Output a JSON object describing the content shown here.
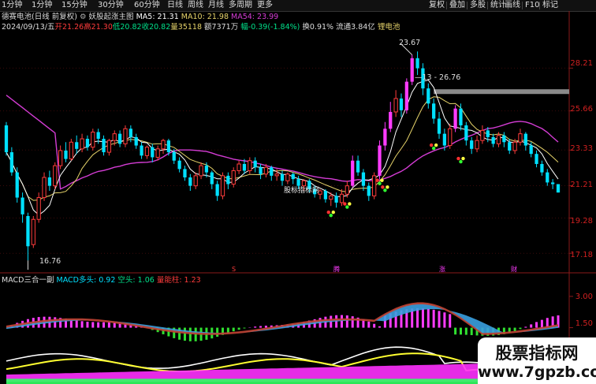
{
  "toolbar": {
    "left_items": [
      "1分钟",
      "1分钟",
      "15分钟",
      "30分钟",
      "60分钟",
      "日线",
      "周线",
      "月线",
      "多周期",
      "更多"
    ],
    "right_items": [
      "复权",
      "叠加",
      "多股",
      "统计",
      "画线",
      "F10",
      "标记"
    ]
  },
  "header": {
    "stock_name": "德赛电池(日线 前复权)",
    "indicator_name": "妖股起涨主图",
    "ma5_label": "MA5: 21.31",
    "ma10_label": "MA10: 21.98",
    "ma54_label": "MA54: 23.99"
  },
  "quote": {
    "date": "2024/09/13/五",
    "open": "开21.26",
    "high": "高21.30",
    "low": "低20.82",
    "close": "收20.82",
    "volume": "量35118",
    "amount": "额7371万",
    "change": "幅-0.39(-1.84%)",
    "turnover": "换0.91%",
    "float_cap": "流通3.84亿",
    "sector": "锂电池"
  },
  "annotations": {
    "peak": "23.67",
    "low": "16.76",
    "level": "—13 - 26.76",
    "site_mark": "股标指标网"
  },
  "signal_marks": [
    "S",
    "腾",
    "涨",
    "财"
  ],
  "price_axis": [
    "28.21",
    "25.66",
    "23.33",
    "21.21",
    "19.28",
    "17.18"
  ],
  "macd": {
    "name": "MACD三合一副",
    "l1": "MACD多头: 0.92",
    "l2": "空头: 1.06",
    "l3": "量能柱: 1.23",
    "axis": [
      "3.00",
      "1.50"
    ]
  },
  "watermark": {
    "title": "股票指标网",
    "url": "www.7gpzb.com"
  },
  "colors": {
    "up": "#ff3c3c",
    "down": "#00e0ff",
    "ma5": "#ffffff",
    "ma10": "#e6d36a",
    "ma54": "#d43cd4",
    "highlight": "#ff3cff"
  },
  "chart_data": {
    "type": "candlestick",
    "note_series": "daily OHLC, approximated",
    "candles": [
      [
        24.8,
        23.2,
        25.0,
        23.0
      ],
      [
        23.2,
        22.0,
        23.5,
        21.8
      ],
      [
        22.0,
        20.5,
        22.3,
        20.2
      ],
      [
        20.5,
        19.5,
        20.8,
        19.0
      ],
      [
        19.4,
        17.6,
        19.6,
        16.76
      ],
      [
        17.7,
        19.2,
        19.4,
        17.5
      ],
      [
        19.2,
        20.5,
        20.8,
        19.0
      ],
      [
        20.5,
        21.7,
        22.0,
        20.3
      ],
      [
        21.7,
        21.2,
        22.1,
        20.9
      ],
      [
        21.2,
        22.4,
        22.6,
        21.0
      ],
      [
        22.4,
        23.3,
        23.6,
        22.2
      ],
      [
        23.3,
        22.8,
        23.8,
        22.6
      ],
      [
        22.8,
        23.8,
        24.0,
        22.7
      ],
      [
        23.8,
        23.4,
        24.2,
        23.1
      ],
      [
        23.4,
        24.0,
        24.3,
        23.2
      ],
      [
        24.0,
        23.5,
        24.2,
        23.3
      ],
      [
        23.5,
        24.4,
        24.6,
        23.3
      ],
      [
        24.4,
        24.0,
        24.6,
        23.7
      ],
      [
        24.0,
        23.2,
        24.2,
        23.0
      ],
      [
        23.2,
        23.9,
        24.0,
        23.0
      ],
      [
        23.9,
        24.3,
        24.5,
        23.6
      ],
      [
        24.3,
        23.7,
        24.5,
        23.5
      ],
      [
        23.7,
        24.6,
        24.8,
        23.5
      ],
      [
        24.6,
        24.1,
        24.8,
        23.8
      ],
      [
        24.1,
        23.6,
        24.3,
        23.4
      ],
      [
        23.6,
        23.0,
        23.8,
        22.8
      ],
      [
        23.0,
        23.5,
        23.6,
        22.8
      ],
      [
        23.5,
        22.9,
        23.7,
        22.6
      ],
      [
        22.9,
        23.4,
        23.6,
        22.7
      ],
      [
        23.4,
        23.9,
        24.0,
        23.1
      ],
      [
        23.9,
        23.2,
        24.0,
        23.0
      ],
      [
        23.2,
        22.7,
        23.4,
        22.5
      ],
      [
        22.7,
        22.2,
        22.9,
        22.0
      ],
      [
        22.2,
        21.7,
        22.4,
        21.5
      ],
      [
        21.7,
        21.2,
        21.9,
        20.9
      ],
      [
        21.2,
        21.8,
        22.0,
        21.0
      ],
      [
        21.8,
        22.4,
        22.6,
        21.6
      ],
      [
        22.4,
        22.0,
        22.6,
        21.7
      ],
      [
        22.0,
        21.3,
        22.1,
        21.0
      ],
      [
        21.3,
        20.6,
        21.5,
        20.3
      ],
      [
        20.6,
        21.8,
        22.0,
        20.4
      ],
      [
        21.8,
        21.3,
        22.0,
        21.0
      ],
      [
        21.3,
        22.1,
        22.3,
        21.1
      ],
      [
        22.1,
        22.5,
        22.7,
        21.9
      ],
      [
        22.5,
        22.1,
        22.8,
        21.9
      ],
      [
        22.1,
        22.7,
        22.9,
        21.9
      ],
      [
        22.7,
        22.3,
        22.9,
        22.0
      ],
      [
        22.3,
        21.9,
        22.5,
        21.6
      ],
      [
        21.9,
        22.3,
        22.5,
        21.7
      ],
      [
        22.3,
        21.8,
        22.4,
        21.5
      ],
      [
        21.8,
        21.9,
        22.2,
        21.5
      ],
      [
        21.9,
        21.5,
        22.1,
        21.2
      ],
      [
        21.5,
        21.9,
        22.0,
        21.3
      ],
      [
        21.9,
        21.6,
        22.0,
        21.3
      ],
      [
        21.6,
        21.2,
        21.8,
        21.0
      ],
      [
        21.2,
        21.5,
        21.6,
        20.9
      ],
      [
        21.5,
        21.0,
        21.6,
        20.8
      ],
      [
        21.0,
        20.7,
        21.2,
        20.5
      ],
      [
        20.7,
        20.9,
        21.0,
        20.4
      ],
      [
        20.9,
        20.4,
        21.0,
        20.2
      ],
      [
        20.4,
        20.6,
        20.8,
        20.0
      ],
      [
        20.6,
        20.2,
        20.8,
        19.9
      ],
      [
        20.2,
        20.7,
        21.0,
        20.0
      ],
      [
        20.7,
        21.2,
        21.5,
        20.5
      ],
      [
        21.2,
        22.7,
        23.0,
        21.1
      ],
      [
        22.7,
        22.0,
        23.0,
        21.8
      ],
      [
        22.0,
        21.2,
        22.2,
        20.9
      ],
      [
        21.2,
        20.6,
        21.4,
        20.3
      ],
      [
        20.6,
        21.8,
        22.0,
        20.4
      ],
      [
        21.8,
        23.6,
        23.9,
        21.6
      ],
      [
        23.6,
        24.6,
        25.0,
        23.3
      ],
      [
        24.6,
        25.6,
        26.2,
        24.4
      ],
      [
        25.6,
        26.4,
        26.9,
        25.3
      ],
      [
        26.4,
        25.7,
        26.7,
        25.3
      ],
      [
        25.7,
        27.4,
        27.6,
        25.5
      ],
      [
        27.4,
        28.8,
        29.0,
        27.2
      ],
      [
        28.8,
        28.2,
        29.2,
        27.8
      ],
      [
        28.2,
        27.0,
        28.5,
        26.6
      ],
      [
        27.0,
        26.1,
        27.3,
        25.8
      ],
      [
        26.1,
        25.2,
        26.4,
        24.9
      ],
      [
        25.2,
        24.3,
        25.6,
        24.0
      ],
      [
        24.3,
        23.6,
        24.6,
        23.3
      ],
      [
        23.6,
        24.6,
        24.9,
        23.4
      ],
      [
        24.6,
        25.8,
        26.0,
        24.4
      ],
      [
        25.8,
        24.8,
        26.1,
        24.5
      ],
      [
        24.8,
        23.9,
        25.0,
        23.6
      ],
      [
        23.9,
        23.4,
        24.1,
        23.1
      ],
      [
        23.4,
        23.9,
        24.2,
        23.2
      ],
      [
        23.9,
        24.5,
        24.8,
        23.7
      ],
      [
        24.5,
        24.1,
        24.7,
        23.8
      ],
      [
        24.1,
        23.7,
        24.3,
        23.5
      ],
      [
        23.7,
        24.2,
        24.4,
        23.5
      ],
      [
        24.2,
        23.8,
        24.4,
        23.5
      ],
      [
        23.8,
        23.3,
        24.0,
        23.1
      ],
      [
        23.3,
        23.8,
        24.0,
        23.1
      ],
      [
        23.8,
        24.3,
        24.6,
        23.6
      ],
      [
        24.3,
        23.6,
        24.4,
        23.3
      ],
      [
        23.6,
        23.1,
        23.8,
        22.9
      ],
      [
        23.1,
        22.5,
        23.3,
        22.3
      ],
      [
        22.5,
        22.0,
        22.7,
        21.8
      ],
      [
        22.0,
        21.4,
        22.2,
        21.2
      ],
      [
        21.4,
        21.3,
        21.6,
        21.0
      ],
      [
        21.3,
        20.8,
        21.3,
        20.8
      ]
    ],
    "y_axis_ticks": [
      28.21,
      25.66,
      23.33,
      21.21,
      19.28,
      17.18
    ]
  }
}
